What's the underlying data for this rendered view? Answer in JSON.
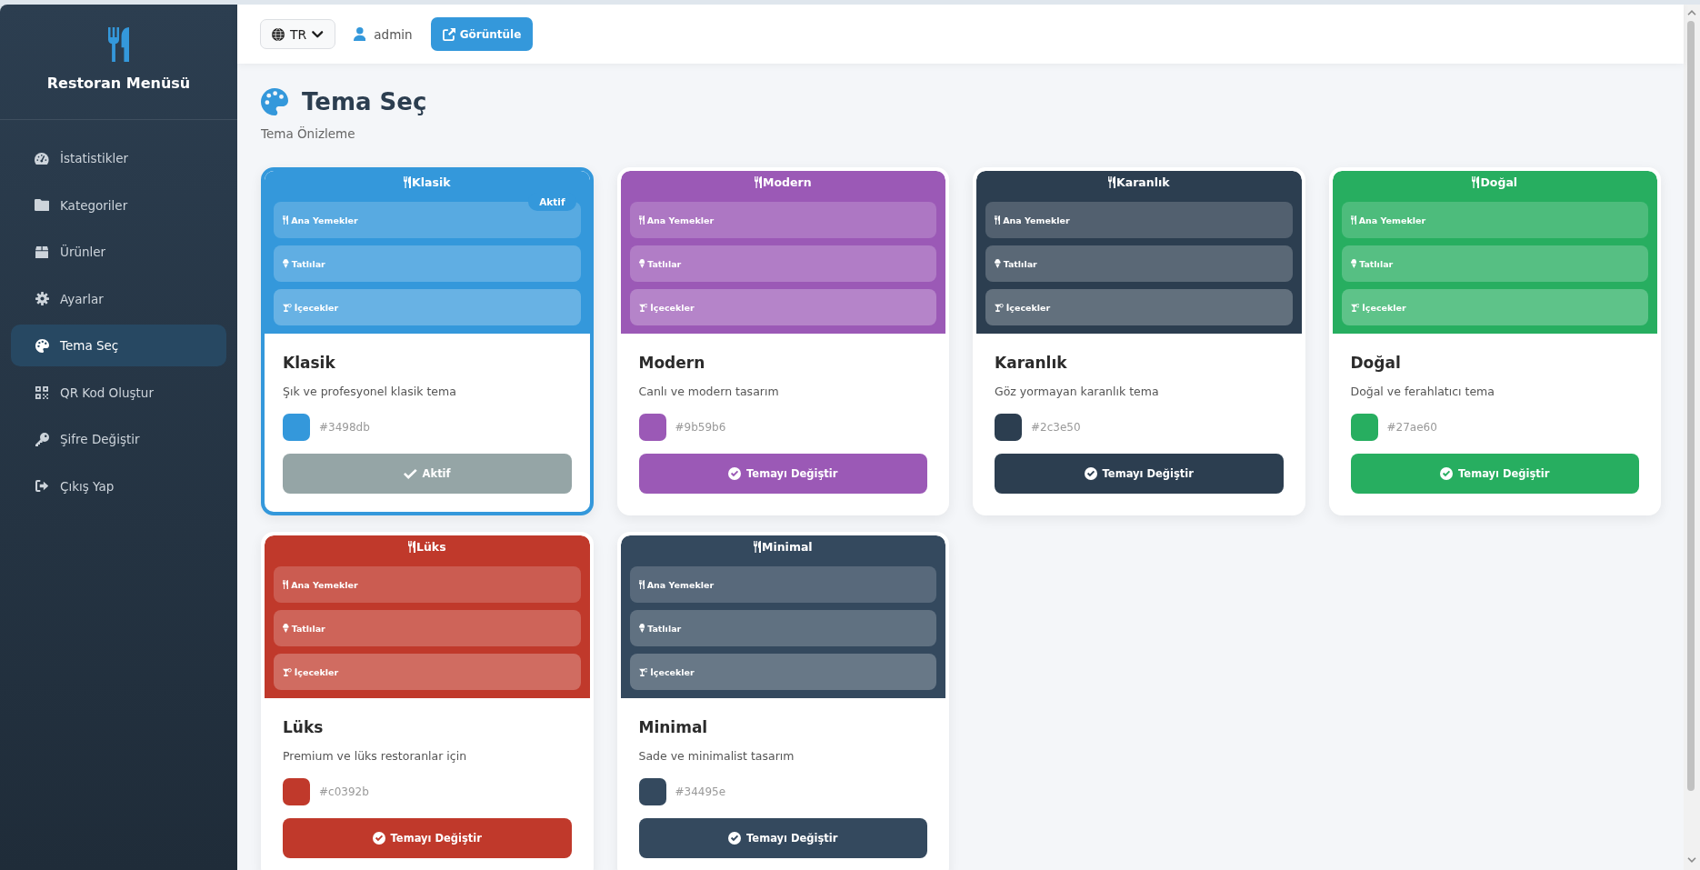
{
  "sidebar": {
    "title": "Restoran Menüsü",
    "items": [
      {
        "label": "İstatistikler",
        "selected": false
      },
      {
        "label": "Kategoriler",
        "selected": false
      },
      {
        "label": "Ürünler",
        "selected": false
      },
      {
        "label": "Ayarlar",
        "selected": false
      },
      {
        "label": "Tema Seç",
        "selected": true
      },
      {
        "label": "QR Kod Oluştur",
        "selected": false
      },
      {
        "label": "Şifre Değiştir",
        "selected": false
      },
      {
        "label": "Çıkış Yap",
        "selected": false
      }
    ]
  },
  "header": {
    "language": "TR",
    "user": "admin",
    "view_button": "Görüntüle"
  },
  "page": {
    "title": "Tema Seç",
    "subtitle": "Tema Önizleme"
  },
  "themes": [
    {
      "preview_title": "Klasik",
      "badge": "Aktif",
      "categories": [
        "Ana Yemekler",
        "Tatlılar",
        "İçecekler"
      ],
      "name": "Klasik",
      "description": "Şık ve profesyonel klasik tema",
      "color": "#3498db",
      "hex": "#3498db",
      "button": "Aktif",
      "selected": true
    },
    {
      "preview_title": "Modern",
      "categories": [
        "Ana Yemekler",
        "Tatlılar",
        "İçecekler"
      ],
      "name": "Modern",
      "description": "Canlı ve modern tasarım",
      "color": "#9b59b6",
      "hex": "#9b59b6",
      "button": "Temayı Değiştir",
      "selected": false
    },
    {
      "preview_title": "Karanlık",
      "categories": [
        "Ana Yemekler",
        "Tatlılar",
        "İçecekler"
      ],
      "name": "Karanlık",
      "description": "Göz yormayan karanlık tema",
      "color": "#2c3e50",
      "hex": "#2c3e50",
      "button": "Temayı Değiştir",
      "selected": false
    },
    {
      "preview_title": "Doğal",
      "categories": [
        "Ana Yemekler",
        "Tatlılar",
        "İçecekler"
      ],
      "name": "Doğal",
      "description": "Doğal ve ferahlatıcı tema",
      "color": "#27ae60",
      "hex": "#27ae60",
      "button": "Temayı Değiştir",
      "selected": false
    },
    {
      "preview_title": "Lüks",
      "categories": [
        "Ana Yemekler",
        "Tatlılar",
        "İçecekler"
      ],
      "name": "Lüks",
      "description": "Premium ve lüks restoranlar için",
      "color": "#c0392b",
      "hex": "#c0392b",
      "button": "Temayı Değiştir",
      "selected": false
    },
    {
      "preview_title": "Minimal",
      "categories": [
        "Ana Yemekler",
        "Tatlılar",
        "İçecekler"
      ],
      "name": "Minimal",
      "description": "Sade ve minimalist tasarım",
      "color": "#34495e",
      "hex": "#34495e",
      "button": "Temayı Değiştir",
      "selected": false
    }
  ]
}
